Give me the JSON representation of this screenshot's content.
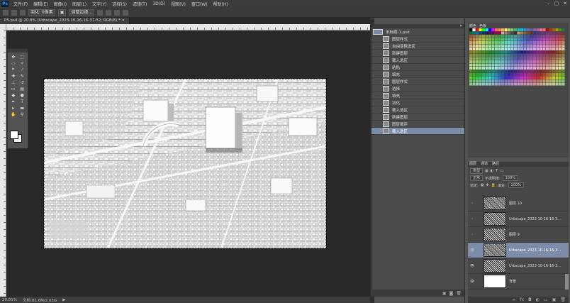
{
  "app": {
    "logo": "Ps"
  },
  "menu": [
    "文件(F)",
    "编辑(E)",
    "图像(I)",
    "图层(L)",
    "文字(Y)",
    "选择(S)",
    "滤镜(T)",
    "3D(D)",
    "视图(V)",
    "窗口(W)",
    "帮助(H)"
  ],
  "window_controls": {
    "minimize": "–",
    "maximize": "▢",
    "close": "✕"
  },
  "options": {
    "tool_label": "羽化: 0像素",
    "mode": "▣",
    "adjust_label": "调整边缘..."
  },
  "doc_tab": {
    "title": "PS.psd @ 20.8% (Urbscape_2023-10-16-16-37-52, RGB/8) *",
    "close": "×"
  },
  "status": {
    "zoom": "20.81%",
    "doc": "文档:81.6M/2.03G",
    "arrow": "▶"
  },
  "history": {
    "header_arrows": "»",
    "snapshot": "未标题-1.psd",
    "items": [
      "图层样式",
      "自由变换选区",
      "新建图层",
      "载入选区",
      "粘贴",
      "填充",
      "图层样式",
      "选择",
      "填充",
      "羽化",
      "载入选区",
      "新建图层",
      "图层顺序",
      "载入选区"
    ],
    "selected_index": 13
  },
  "swatches": {
    "tabs": [
      "颜色",
      "色板"
    ],
    "colors": [
      "#000000",
      "#ffffff",
      "#ff0000",
      "#ffff00",
      "#00ff00",
      "#00ffff",
      "#0000ff",
      "#ff00ff",
      "#f26c4f",
      "#f68e55",
      "#fbaf5c",
      "#fff467",
      "#acd372",
      "#7cc576",
      "#3bb878",
      "#1abbb4",
      "#00bff3",
      "#438cca",
      "#5574b9",
      "#605ca8",
      "#855fa8",
      "#a763a8",
      "#f06ea9",
      "#f26d7d",
      "#9e0b0f",
      "#a0410d",
      "#a3620a",
      "#aba000",
      "#598527",
      "#1a7b30",
      "#007236",
      "#00746b",
      "#0076a3",
      "#004b80",
      "#003471",
      "#1b1464",
      "#440e62",
      "#630460",
      "#9e005d",
      "#9e0039",
      "#c7b299",
      "#998675",
      "#736357",
      "#534741",
      "#37302d",
      "#c69c6d",
      "#a67c52",
      "#8c6239",
      "#754c24",
      "#603913"
    ]
  },
  "layers": {
    "tabs": [
      "图层",
      "通道",
      "路径"
    ],
    "filter_kind": "类型",
    "blend_mode": "正常",
    "opacity_label": "不透明度:",
    "opacity": "100%",
    "lock_label": "锁定:",
    "fill_label": "填充:",
    "fill": "100%",
    "items": [
      {
        "name": "图层 10",
        "visible": false,
        "thumb": "noise"
      },
      {
        "name": "Urbscape_2023-10-16-16-3...",
        "visible": false,
        "thumb": "noise"
      },
      {
        "name": "图层 9",
        "visible": false,
        "thumb": "noise"
      },
      {
        "name": "Urbscape_2023-10-16-16-3...",
        "visible": true,
        "thumb": "noise"
      },
      {
        "name": "Urbscape_2023-10-16-16-3...",
        "visible": true,
        "thumb": "noise"
      },
      {
        "name": "背景",
        "visible": true,
        "thumb": "white"
      }
    ],
    "selected_index": 3
  },
  "colors": {
    "accent": "#7c8ca9",
    "panel": "#474747",
    "canvas_bg": "#282828"
  }
}
